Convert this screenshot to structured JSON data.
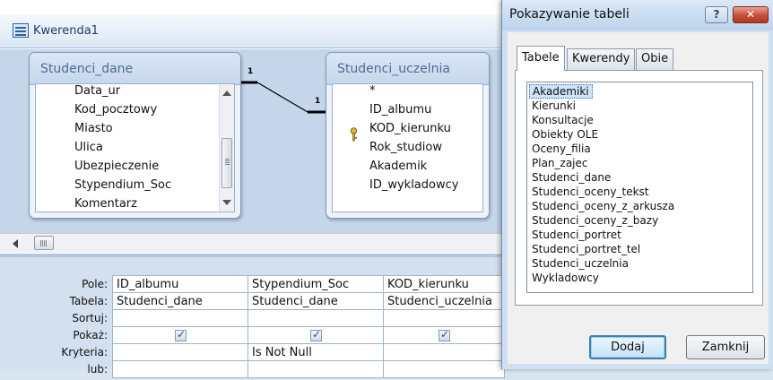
{
  "query_window": {
    "title": "Kwerenda1",
    "tables": [
      {
        "name": "Studenci_dane",
        "fields": [
          "Data_ur",
          "Kod_pocztowy",
          "Miasto",
          "Ulica",
          "Ubezpieczenie",
          "Stypendium_Soc",
          "Komentarz"
        ]
      },
      {
        "name": "Studenci_uczelnia",
        "fields": [
          "*",
          "ID_albumu",
          "KOD_kierunku",
          "Rok_studiow",
          "Akademik",
          "ID_wykladowcy"
        ]
      }
    ],
    "relationship": {
      "left_end": "1",
      "right_end": "1"
    },
    "grid": {
      "row_labels": [
        "Pole:",
        "Tabela:",
        "Sortuj:",
        "Pokaż:",
        "Kryteria:",
        "lub:"
      ],
      "columns": [
        {
          "pole": "ID_albumu",
          "tabela": "Studenci_dane",
          "sortuj": "",
          "pokaz": true,
          "kryteria": ""
        },
        {
          "pole": "Stypendium_Soc",
          "tabela": "Studenci_dane",
          "sortuj": "",
          "pokaz": true,
          "kryteria": "Is Not Null"
        },
        {
          "pole": "KOD_kierunku",
          "tabela": "Studenci_uczelnia",
          "sortuj": "",
          "pokaz": true,
          "kryteria": ""
        }
      ]
    }
  },
  "dialog": {
    "title": "Pokazywanie tabeli",
    "help_label": "?",
    "close_label": "✕",
    "tabs": [
      "Tabele",
      "Kwerendy",
      "Obie"
    ],
    "active_tab": "Tabele",
    "tables": [
      "Akademiki",
      "Kierunki",
      "Konsultacje",
      "Obiekty OLE",
      "Oceny_filia",
      "Plan_zajec",
      "Studenci_dane",
      "Studenci_oceny_tekst",
      "Studenci_oceny_z_arkusza",
      "Studenci_oceny_z_bazy",
      "Studenci_portret",
      "Studenci_portret_tel",
      "Studenci_uczelnia",
      "Wykladowcy"
    ],
    "selected_table": "Akademiki",
    "add_label": "Dodaj",
    "close_button_label": "Zamknij"
  },
  "colors": {
    "accent": "#3c7fb1",
    "design_background": "#c5d6ea",
    "close_red": "#c44e36"
  }
}
